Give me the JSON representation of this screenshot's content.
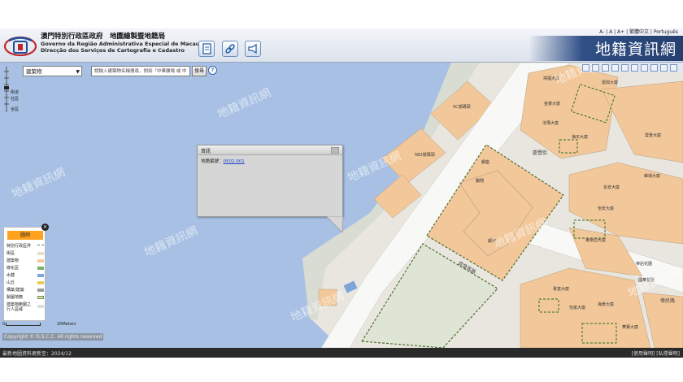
{
  "header": {
    "lang_links": "A- | A | A+ | 繁體中文 | Português",
    "dept_chinese": "澳門特別行政區政府　地圖繪製暨地籍局",
    "dept_line2": "Governo da Região Administrativa Especial de Macau",
    "dept_line3": "Direcção dos Serviços de Cartografia e Cadastro",
    "site_title": "地籍資訊網",
    "buttons": [
      "document-icon",
      "link-icon",
      "megaphone-icon"
    ]
  },
  "search": {
    "category": "建築物",
    "placeholder": "請輸入建築物名稱搜尋，例如「中華廣場 或 中",
    "button_label": "搜尋",
    "help": "?"
  },
  "zoom": {
    "labels": [
      "街道",
      "社區",
      "全區"
    ]
  },
  "map": {
    "building_labels": [
      "5C號碼頭",
      "5B2號碼頭",
      "銀座",
      "鵬翔",
      "銀河",
      "金泰大廈",
      "法瑪大廈",
      "鴻福大廈",
      "嘉興大廈",
      "海天大廈",
      "永安大廈",
      "東南亞大廈",
      "維城大廈",
      "怡安大廈",
      "帝后花園",
      "景富大廈",
      "海景大廈",
      "怡富大廈",
      "國華花園",
      "華寶大廈",
      "雲景大廈"
    ],
    "road_labels": [
      "提督馬路",
      "慶豐街",
      "偉民路"
    ]
  },
  "watermark": "地籍資訊網",
  "popup": {
    "title": "資訊",
    "field_label": "地籍編號：",
    "field_value": "0502.001"
  },
  "legend": {
    "title": "圖例",
    "items": [
      {
        "label": "特別行政區界",
        "color": "#777777"
      },
      {
        "label": "街區",
        "color": "#e8e0cc"
      },
      {
        "label": "建築物",
        "color": "#f2c89a"
      },
      {
        "label": "綠化區",
        "color": "#7fb069"
      },
      {
        "label": "水體",
        "color": "#7ea5d8"
      },
      {
        "label": "山丘",
        "color": "#e9cc5a"
      },
      {
        "label": "構築/建築",
        "color": "#999999"
      },
      {
        "label": "製圖地籍",
        "color": "#cfe6a8"
      },
      {
        "label": "建築物範圍之",
        "color": "#dddddd"
      },
      {
        "label": "行人區域",
        "color": "#ffffff"
      }
    ]
  },
  "scale": {
    "left": "0",
    "right": "20Meters"
  },
  "copyright": "Copyright © D.S.C.C. All rights reserved",
  "footer": {
    "left": "最新地圖資料更新至：2024/12",
    "right": "[使用聲明] [私隱聲明]"
  }
}
